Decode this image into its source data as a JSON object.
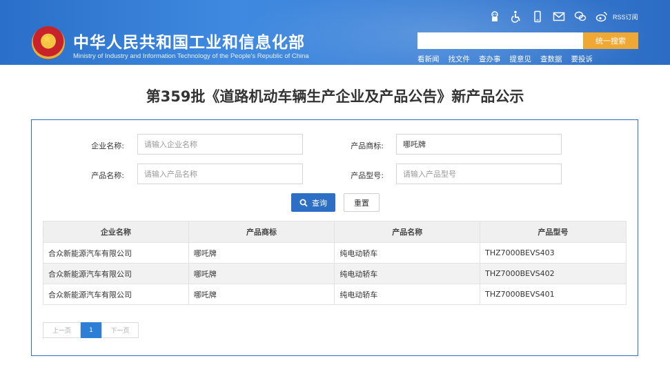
{
  "header": {
    "title": "中华人民共和国工业和信息化部",
    "subtitle": "Ministry of Industry and Information Technology of the People's Republic of China",
    "rss_label": "RSS订阅",
    "search_button": "统一搜索",
    "search_placeholder": "",
    "quick_links": [
      "看新闻",
      "找文件",
      "查办事",
      "提意见",
      "查数据",
      "要投诉"
    ],
    "toolbar_icons": [
      "robot-icon",
      "accessibility-icon",
      "mobile-icon",
      "mail-icon",
      "wechat-icon",
      "weibo-icon"
    ]
  },
  "page": {
    "title": "第359批《道路机动车辆生产企业及产品公告》新产品公示"
  },
  "form": {
    "company_label": "企业名称:",
    "company_placeholder": "请输入企业名称",
    "brand_label": "产品商标:",
    "brand_value": "哪吒牌",
    "product_label": "产品名称:",
    "product_placeholder": "请输入产品名称",
    "model_label": "产品型号:",
    "model_placeholder": "请输入产品型号",
    "query_button": "查询",
    "reset_button": "重置"
  },
  "table": {
    "headers": [
      "企业名称",
      "产品商标",
      "产品名称",
      "产品型号"
    ],
    "rows": [
      [
        "合众新能源汽车有限公司",
        "哪吒牌",
        "纯电动轿车",
        "THZ7000BEVS403"
      ],
      [
        "合众新能源汽车有限公司",
        "哪吒牌",
        "纯电动轿车",
        "THZ7000BEVS402"
      ],
      [
        "合众新能源汽车有限公司",
        "哪吒牌",
        "纯电动轿车",
        "THZ7000BEVS401"
      ]
    ]
  },
  "pagination": {
    "prev": "上一页",
    "current": "1",
    "next": "下一页"
  },
  "colors": {
    "header_blue": "#3a7fd6",
    "accent_orange": "#f0a834",
    "primary_blue": "#2d6fc4"
  }
}
